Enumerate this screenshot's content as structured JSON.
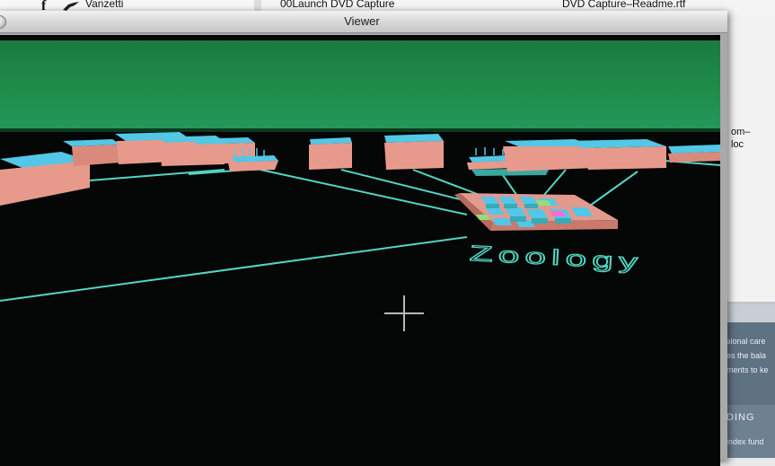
{
  "background_finder": {
    "left_item_label": "Vanzetti",
    "file_1": "00Launch DVD Capture",
    "file_2": "DVD Capture–Readme.rtf"
  },
  "background_right": {
    "text_lines": [
      "om–",
      "loc"
    ],
    "panel_lines": [
      "sional care",
      "es the bala",
      "ments to ke"
    ],
    "panel_heading": "DING",
    "panel_footer": "index fund"
  },
  "viewer": {
    "title": "Viewer",
    "scene_label": "Zoology"
  },
  "colors": {
    "sky_green": "#1f8e4a",
    "block_pink": "#e79a8c",
    "block_cyan": "#52c7e6",
    "wire_teal": "#52d6c2"
  }
}
